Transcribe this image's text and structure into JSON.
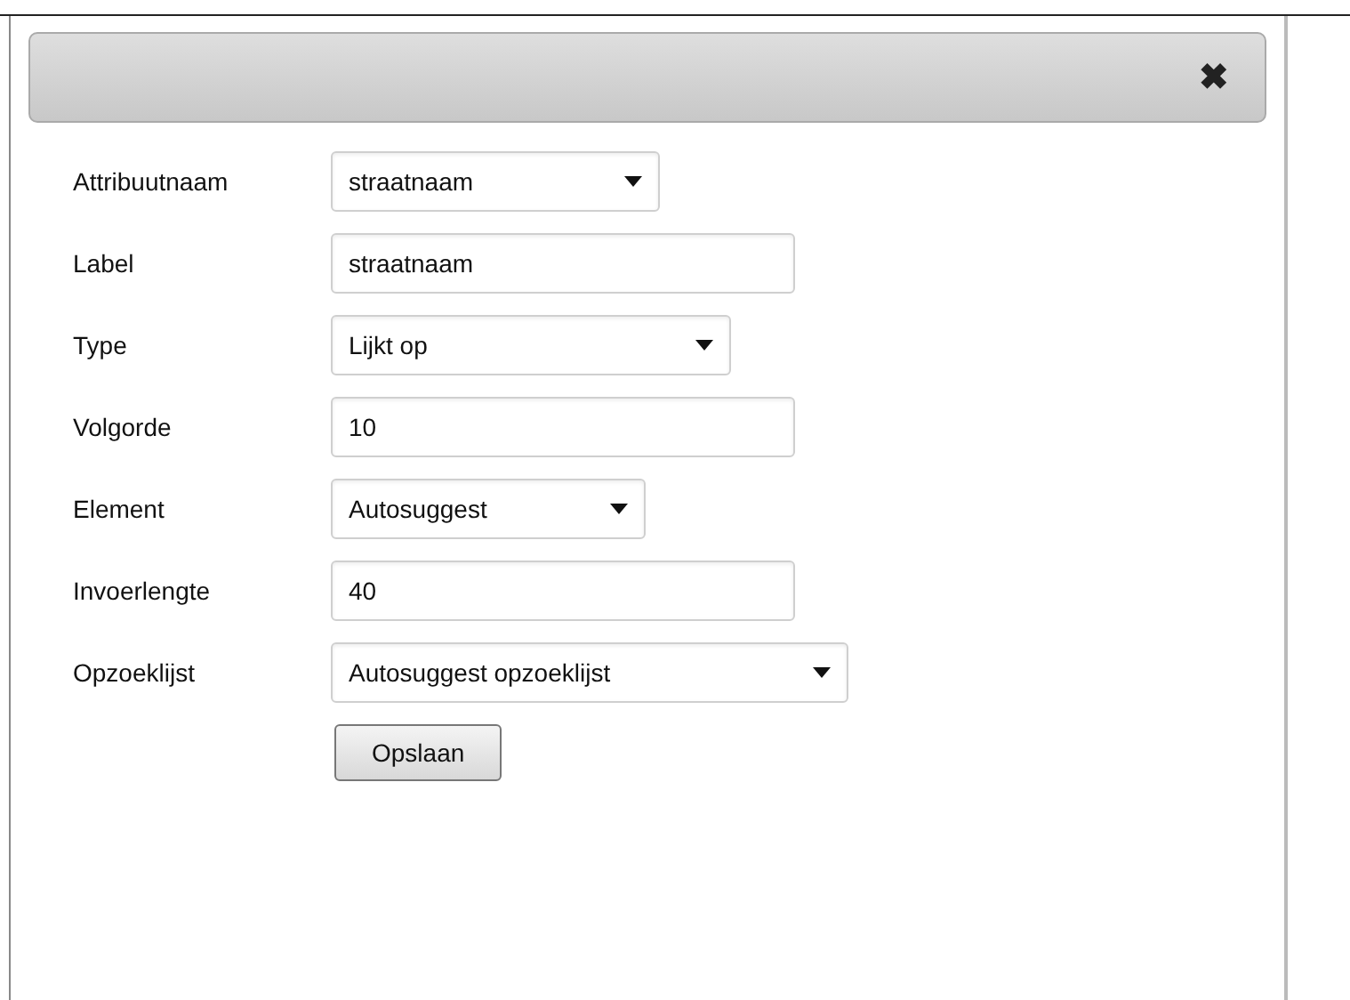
{
  "dialog": {
    "close_icon": "✖"
  },
  "fields": [
    {
      "label": "Attribuutnaam",
      "kind": "select",
      "value": "straatnaam"
    },
    {
      "label": "Label",
      "kind": "text",
      "value": "straatnaam"
    },
    {
      "label": "Type",
      "kind": "select",
      "value": "Lijkt op"
    },
    {
      "label": "Volgorde",
      "kind": "text",
      "value": "10"
    },
    {
      "label": "Element",
      "kind": "select",
      "value": "Autosuggest"
    },
    {
      "label": "Invoerlengte",
      "kind": "text",
      "value": "40"
    },
    {
      "label": "Opzoeklijst",
      "kind": "select",
      "value": "Autosuggest opzoeklijst"
    }
  ],
  "buttons": [
    "Opslaan"
  ]
}
